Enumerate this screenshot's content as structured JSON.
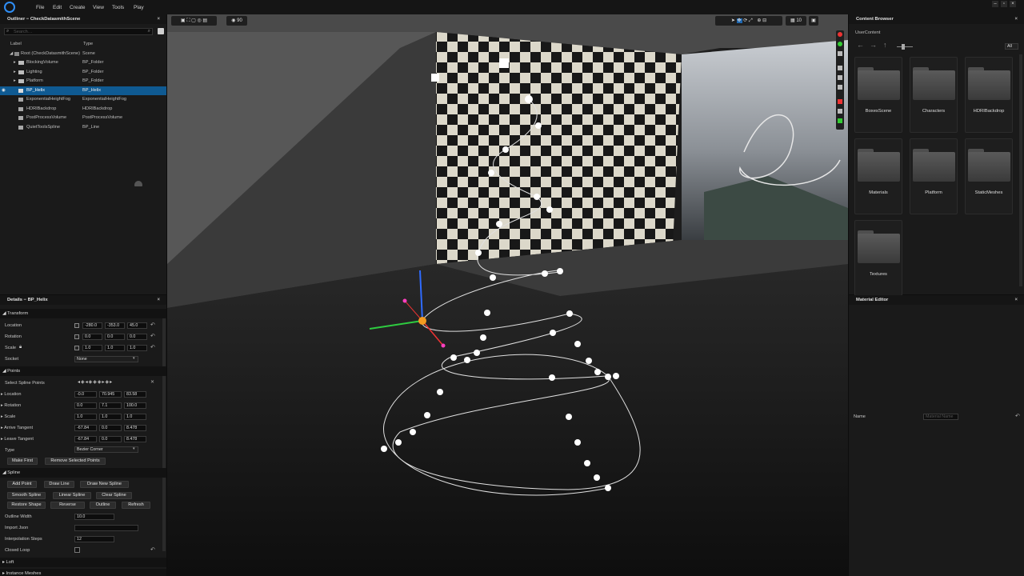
{
  "menu": {
    "file": "File",
    "edit": "Edit",
    "create": "Create",
    "view": "View",
    "tools": "Tools",
    "play": "Play"
  },
  "window": {
    "minimize": "–",
    "maximize": "▫",
    "close": "×"
  },
  "outliner": {
    "title": "Outliner − CheckDatasmithScene",
    "close": "×",
    "search_placeholder": "Search…",
    "col_label": "Label",
    "col_type": "Type",
    "rows": [
      {
        "label": "Root (CheckDatasmithScene)",
        "type": "Scene"
      },
      {
        "label": "BlockingVolume",
        "type": "BP_Folder"
      },
      {
        "label": "Lighting",
        "type": "BP_Folder"
      },
      {
        "label": "Platform",
        "type": "BP_Folder"
      },
      {
        "label": "BP_Helix",
        "type": "BP_Helix"
      },
      {
        "label": "ExponentialHeightFog",
        "type": "ExponentialHeightFog"
      },
      {
        "label": "HDRIBackdrop",
        "type": "HDRIBackdrop"
      },
      {
        "label": "PostProcessVolume",
        "type": "PostProcessVolume"
      },
      {
        "label": "QuietToolsSpline",
        "type": "BP_Line"
      }
    ]
  },
  "details": {
    "title": "Details − BP_Helix",
    "close": "×",
    "transform": {
      "section": "Transform",
      "location_label": "Location",
      "location": [
        "-280.0",
        "-353.0",
        "45.0"
      ],
      "rotation_label": "Rotation",
      "rotation": [
        "0.0",
        "0.0",
        "0.0"
      ],
      "scale_label": "Scale",
      "scale": [
        "1.0",
        "1.0",
        "1.0"
      ],
      "socket_label": "Socket",
      "socket_value": "None"
    },
    "points": {
      "section": "Points",
      "select_label": "Select Spline Points",
      "location_label": "Location",
      "location": [
        "-0.0",
        "70.945",
        "83.58"
      ],
      "rotation_label": "Rotation",
      "rotation": [
        "0.0",
        "7.1",
        "100.0"
      ],
      "scale_label": "Scale",
      "scale": [
        "1.0",
        "1.0",
        "1.0"
      ],
      "arrive_label": "Arrive Tangent",
      "arrive": [
        "-67.84",
        "0.0",
        "8.478"
      ],
      "leave_label": "Leave Tangent",
      "leave": [
        "-67.84",
        "0.0",
        "8.478"
      ],
      "type_label": "Type",
      "type_value": "Bezier Corner",
      "make_first": "Make First",
      "remove_selected": "Remove Selected Points"
    },
    "spline": {
      "section": "Spline",
      "add_point": "Add Point",
      "draw_line": "Draw Line",
      "draw_new_spline": "Draw New Spline",
      "smooth_spline": "Smooth Spline",
      "linear_spline": "Linear Spline",
      "clear_spline": "Clear Spline",
      "restore_shape": "Restore Shape",
      "reverse": "Reverse",
      "outline": "Outline",
      "refresh": "Refresh",
      "outline_width_label": "Outline Width",
      "outline_width": "10.0",
      "import_json_label": "Import Json",
      "interp_label": "Interpolation Steps",
      "interp_value": "12",
      "closed_loop_label": "Closed Loop"
    },
    "loft": "Loft",
    "instance_meshes": "Instance Meshes"
  },
  "viewport": {
    "fov": "90",
    "grid": "10"
  },
  "content_browser": {
    "title": "Content Browser",
    "close": "×",
    "path": "UserContent",
    "filter": "All",
    "folders": [
      "BoxesScene",
      "Characters",
      "HDRIBackdrop",
      "Materials",
      "Platform",
      "StaticMeshes",
      "Textures"
    ]
  },
  "material_editor": {
    "title": "Material Editor",
    "close": "×",
    "name_label": "Name",
    "name_placeholder": "Material Name"
  }
}
